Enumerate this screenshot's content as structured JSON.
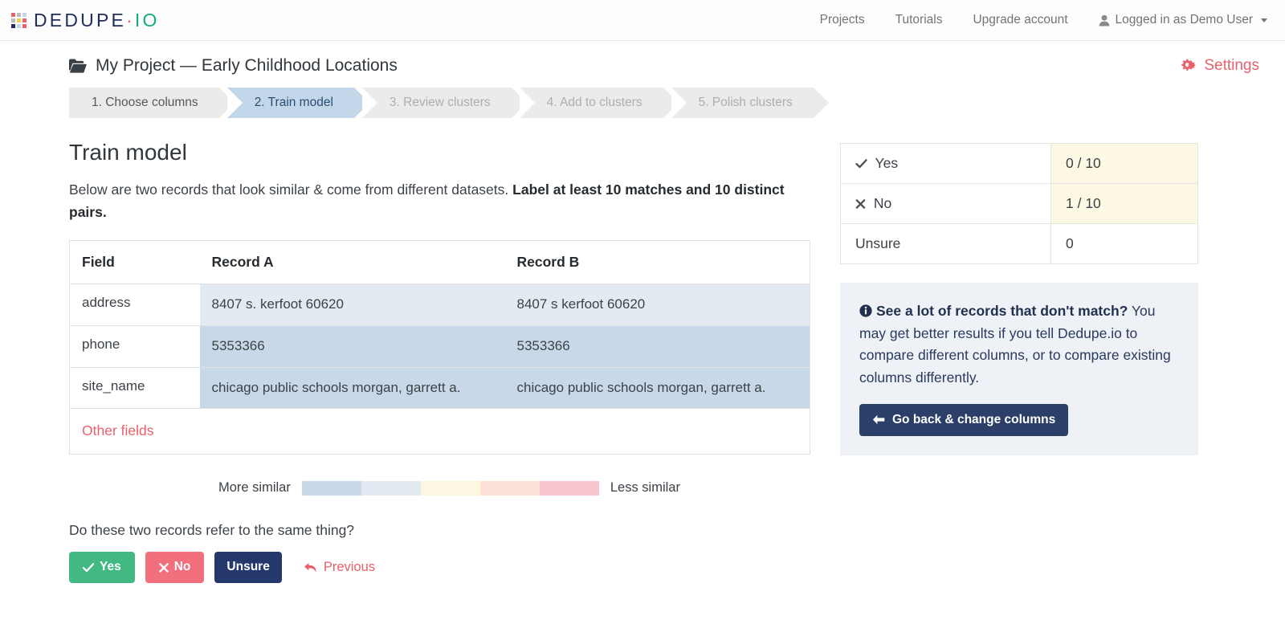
{
  "brand": {
    "name_part1": "DEDUPE",
    "separator": "·",
    "name_part2": "IO",
    "logo_icon": "dot-grid-icon",
    "logo_colors": [
      "#e8616b",
      "#b9bcc0",
      "#c3d7ea",
      "#b9bcc0",
      "#f2d24b",
      "#e8616b",
      "#1f2d5c",
      "#c3d7ea",
      "#e8616b"
    ]
  },
  "nav": {
    "links": [
      {
        "label": "Projects",
        "name": "nav-link-projects"
      },
      {
        "label": "Tutorials",
        "name": "nav-link-tutorials"
      },
      {
        "label": "Upgrade account",
        "name": "nav-link-upgrade-account"
      }
    ],
    "user": {
      "label": "Logged in as Demo User",
      "icon": "user-icon",
      "caret": "chevron-down-icon"
    }
  },
  "project": {
    "icon": "folder-open-icon",
    "title": "My Project — Early Childhood Locations",
    "settings_label": "Settings",
    "settings_icon": "gears-icon",
    "settings_color": "#e8616b"
  },
  "stepper": {
    "steps": [
      {
        "label": "1. Choose columns",
        "state": "done"
      },
      {
        "label": "2. Train model",
        "state": "active"
      },
      {
        "label": "3. Review clusters",
        "state": "disabled"
      },
      {
        "label": "4. Add to clusters",
        "state": "disabled"
      },
      {
        "label": "5. Polish clusters",
        "state": "disabled"
      }
    ],
    "active_color": "#c3d7ea",
    "inactive_color": "#ebebeb"
  },
  "main": {
    "heading": "Train model",
    "lede_normal": "Below are two records that look similar & come from different datasets. ",
    "lede_bold": "Label at least 10 matches and 10 distinct pairs.",
    "table": {
      "headers": [
        "Field",
        "Record A",
        "Record B"
      ],
      "rows": [
        {
          "field": "address",
          "a": "8407 s. kerfoot 60620",
          "b": "8407 s kerfoot 60620"
        },
        {
          "field": "phone",
          "a": "5353366",
          "b": "5353366"
        },
        {
          "field": "site_name",
          "a": "chicago public schools morgan, garrett a.",
          "b": "chicago public schools morgan, garrett a."
        }
      ],
      "other_fields_label": "Other fields"
    },
    "legend": {
      "left_label": "More similar",
      "right_label": "Less similar",
      "colors": [
        "#c9d8e8",
        "#e3eaf2",
        "#fbf7e0",
        "#fbe1d7",
        "#f8c6ce"
      ]
    },
    "question": "Do these two records refer to the same thing?",
    "buttons": {
      "yes": {
        "label": "Yes",
        "icon": "check-icon",
        "color": "#42b883"
      },
      "no": {
        "label": "No",
        "icon": "times-icon",
        "color": "#f2707d"
      },
      "unsure": {
        "label": "Unsure",
        "color": "#25386b"
      },
      "previous": {
        "label": "Previous",
        "icon": "undo-arrow-icon",
        "color": "#e8616b"
      }
    }
  },
  "sidebar": {
    "stats": [
      {
        "icon": "check-icon",
        "label": "Yes",
        "value": "0 / 10",
        "highlight": true
      },
      {
        "icon": "times-icon",
        "label": "No",
        "value": "1 / 10",
        "highlight": true
      },
      {
        "icon": "",
        "label": "Unsure",
        "value": "0",
        "highlight": false
      }
    ],
    "highlight_color": "#fcf8e3",
    "info": {
      "icon": "info-circle-icon",
      "bold_text": "See a lot of records that don't match?",
      "body_text": " You may get better results if you tell Dedupe.io to compare different columns, or to compare existing columns differently.",
      "button_label": "Go back & change columns",
      "button_icon": "arrow-left-icon",
      "button_color": "#2b3f68",
      "panel_color": "#eef1f5"
    }
  }
}
